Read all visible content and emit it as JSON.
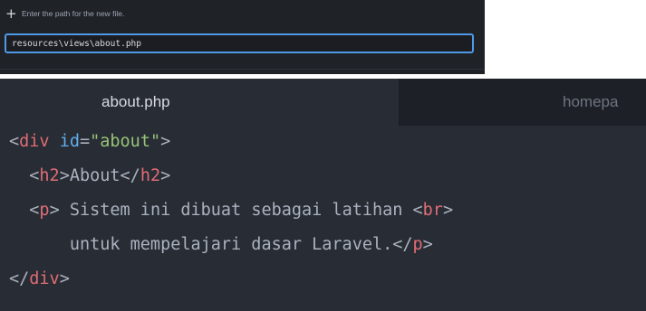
{
  "new_file_prompt": {
    "icon": "plus-icon",
    "label": "Enter the path for the new file.",
    "path_value": "resources\\views\\about.php",
    "accent_color": "#4f9ae6"
  },
  "editor": {
    "tabs": [
      {
        "label": "about.php",
        "active": true
      },
      {
        "label": "homepa",
        "active": false
      }
    ],
    "code": {
      "line1": {
        "open": "<",
        "tag": "div",
        "space": " ",
        "attr": "id",
        "eq": "=",
        "value": "\"about\"",
        "close": ">"
      },
      "line2": {
        "indent": "  ",
        "open": "<",
        "tag": "h2",
        "gt": ">",
        "text": "About",
        "open_end": "</",
        "tag_end": "h2",
        "close": ">"
      },
      "line3": {
        "indent": "  ",
        "open": "<",
        "tag": "p",
        "gt": ">",
        "text": " Sistem ini dibuat sebagai latihan ",
        "br_open": "<",
        "br_tag": "br",
        "br_close": ">"
      },
      "line4": {
        "indent": "      ",
        "text": "untuk mempelajari dasar Laravel.",
        "open_end": "</",
        "tag_end": "p",
        "close": ">"
      },
      "line5": {
        "open_end": "</",
        "tag_end": "div",
        "close": ">"
      }
    },
    "colors": {
      "tag": "#e06c75",
      "attribute": "#61afef",
      "string": "#98c379",
      "text": "#abb2bf",
      "background": "#282c34"
    }
  }
}
